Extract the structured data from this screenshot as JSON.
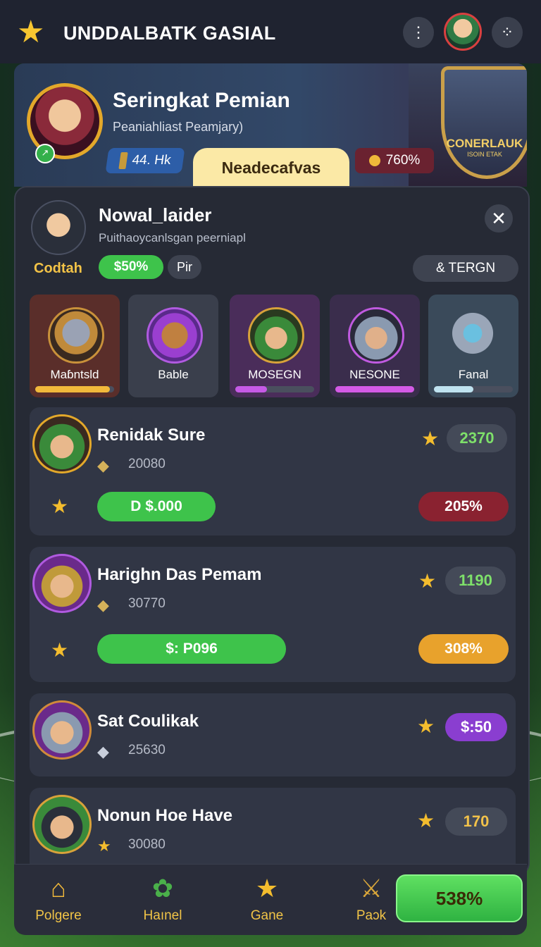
{
  "header": {
    "title": "UNDDALBATK GASIAL",
    "icons": [
      "star-icon",
      "more-vertical-icon",
      "avatar",
      "menu-dots-icon"
    ]
  },
  "hero": {
    "title": "Seringkat Pemian",
    "subtitle": "Peaniahliast Peamjary)",
    "stat_blue": "44. Hk",
    "tab_label": "Neadecafvas",
    "stat_red": "760%",
    "badge_title": "CONERLAUK",
    "badge_sub": "ISOIN ETAK"
  },
  "profile": {
    "name": "Nowal_laider",
    "subtitle": "Puithaoycanlsgan peerniapl",
    "rank": "Codtah",
    "pill_green": "$50%",
    "pill_grey": "Pir",
    "tern_button": "& TERGN"
  },
  "categories": [
    {
      "label": "Maɓntsld",
      "icon": "knight-helmet-icon",
      "bar_color": "#f2b93b",
      "progress": 0.95,
      "bg": "#5a2e2a"
    },
    {
      "label": "Bable",
      "icon": "treasure-chest-icon",
      "bar_color": "#4a4f5e",
      "progress": 0.0,
      "bg": "#3a3f4c"
    },
    {
      "label": "MOSEGN",
      "icon": "green-hat-hero-icon",
      "bar_color": "#c65ae6",
      "progress": 0.4,
      "bg": "#4a2d5a"
    },
    {
      "label": "NESONE",
      "icon": "helmet-warrior-icon",
      "bar_color": "#d45ae6",
      "progress": 1.0,
      "bg": "#3a2d4c"
    },
    {
      "label": "Fanal",
      "icon": "gear-orb-icon",
      "bar_color": "#bfe3f0",
      "progress": 0.5,
      "bg": "#3a4a5a"
    }
  ],
  "players": [
    {
      "name": "Renidak Sure",
      "number": "20080",
      "score": "2370",
      "score_color": "#7ee06a",
      "bar_left": "D $.000",
      "bar_right": "205%",
      "bar_right_color": "#8a2230"
    },
    {
      "name": "Harighn Das Pemam",
      "number": "30770",
      "score": "1190",
      "score_color": "#7ee06a",
      "bar_left": "$: P096",
      "bar_right": "308%",
      "bar_right_color": "#e8a22c"
    },
    {
      "name": "Sat Coulikak",
      "number": "25630",
      "score": "$:50",
      "score_color": "#ffffff"
    },
    {
      "name": "Nonun Hoe Have",
      "number": "30080",
      "score": "170",
      "score_color": "#f2c24a"
    }
  ],
  "nav": {
    "items": [
      {
        "label": "Polgere",
        "icon": "home-icon"
      },
      {
        "label": "Haınel",
        "icon": "plant-icon"
      },
      {
        "label": "Gane",
        "icon": "star-icon"
      },
      {
        "label": "Paɔk",
        "icon": "sword-icon"
      }
    ],
    "cta": "538%"
  }
}
